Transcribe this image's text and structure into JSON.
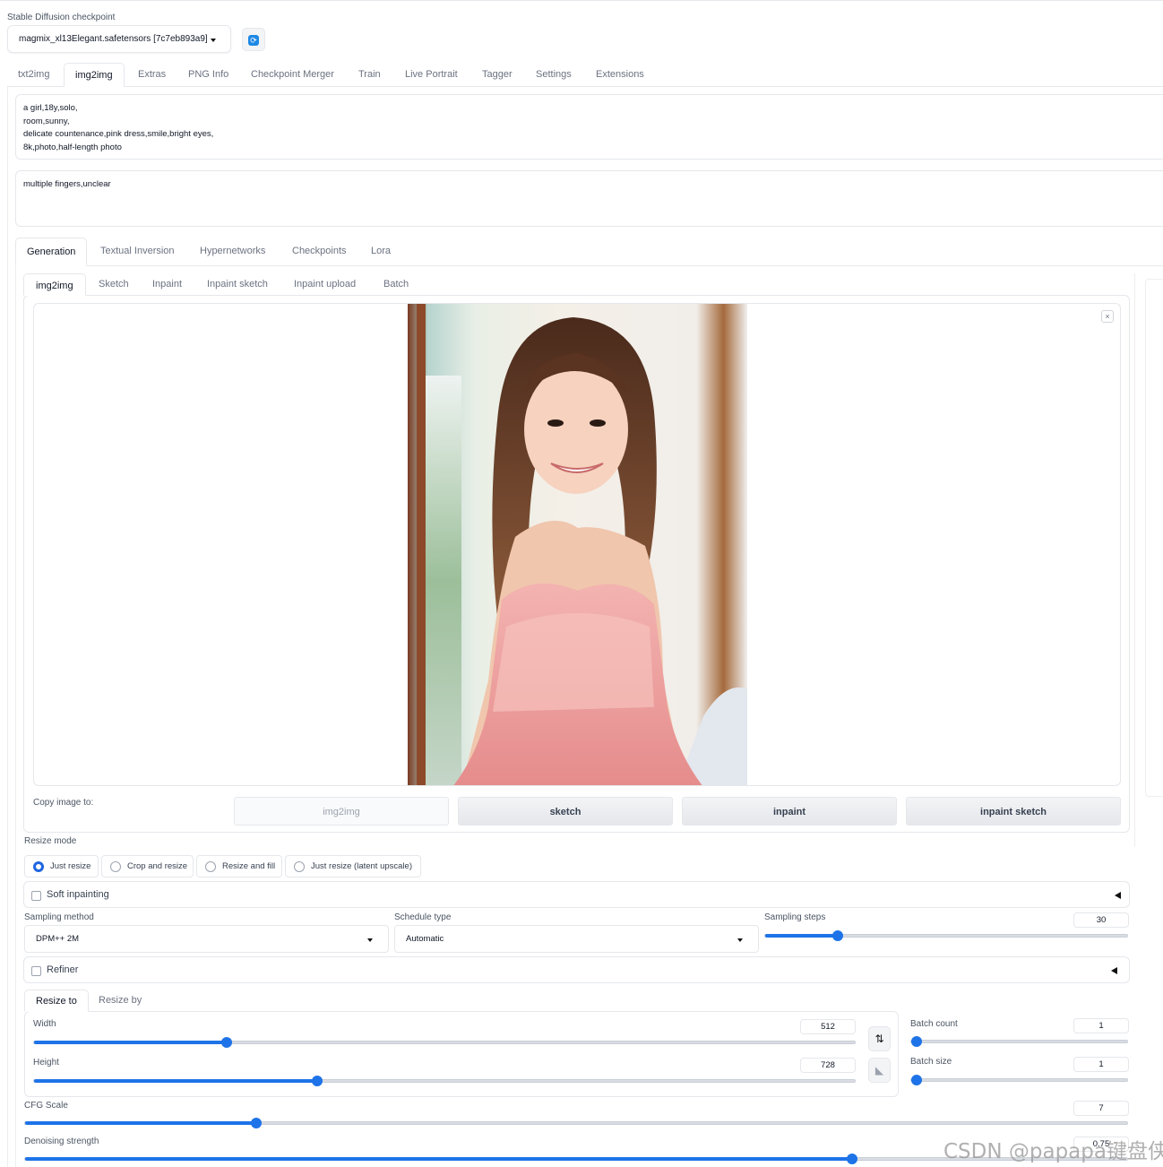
{
  "checkpoint": {
    "label": "Stable Diffusion checkpoint",
    "value": "magmix_xl13Elegant.safetensors [7c7eb893a9]"
  },
  "main_tabs": [
    {
      "label": "txt2img",
      "active": false
    },
    {
      "label": "img2img",
      "active": true
    },
    {
      "label": "Extras",
      "active": false
    },
    {
      "label": "PNG Info",
      "active": false
    },
    {
      "label": "Checkpoint Merger",
      "active": false
    },
    {
      "label": "Train",
      "active": false
    },
    {
      "label": "Live Portrait",
      "active": false
    },
    {
      "label": "Tagger",
      "active": false
    },
    {
      "label": "Settings",
      "active": false
    },
    {
      "label": "Extensions",
      "active": false
    }
  ],
  "prompt": {
    "positive": "a girl,18y,solo,\nroom,sunny,\ndelicate countenance,pink dress,smile,bright eyes,\n8k,photo,half-length photo",
    "negative": "multiple fingers,unclear"
  },
  "sub_tabs": [
    {
      "label": "Generation",
      "active": true
    },
    {
      "label": "Textual Inversion",
      "active": false
    },
    {
      "label": "Hypernetworks",
      "active": false
    },
    {
      "label": "Checkpoints",
      "active": false
    },
    {
      "label": "Lora",
      "active": false
    }
  ],
  "mode_tabs": [
    {
      "label": "img2img",
      "active": true
    },
    {
      "label": "Sketch",
      "active": false
    },
    {
      "label": "Inpaint",
      "active": false
    },
    {
      "label": "Inpaint sketch",
      "active": false
    },
    {
      "label": "Inpaint upload",
      "active": false
    },
    {
      "label": "Batch",
      "active": false
    }
  ],
  "image_close": "×",
  "copy_to": {
    "label": "Copy image to:",
    "buttons": [
      {
        "label": "img2img",
        "disabled": true
      },
      {
        "label": "sketch",
        "disabled": false
      },
      {
        "label": "inpaint",
        "disabled": false
      },
      {
        "label": "inpaint sketch",
        "disabled": false
      }
    ]
  },
  "resize_mode": {
    "label": "Resize mode",
    "options": [
      "Just resize",
      "Crop and resize",
      "Resize and fill",
      "Just resize (latent upscale)"
    ],
    "selected": "Just resize"
  },
  "soft_inpainting": "Soft inpainting",
  "sampling": {
    "method_label": "Sampling method",
    "method": "DPM++ 2M",
    "schedule_label": "Schedule type",
    "schedule": "Automatic",
    "steps_label": "Sampling steps",
    "steps": "30",
    "steps_fraction": 0.2
  },
  "refiner": "Refiner",
  "size_tabs": [
    {
      "label": "Resize to",
      "active": true
    },
    {
      "label": "Resize by",
      "active": false
    }
  ],
  "dimensions": {
    "width_label": "Width",
    "width": "512",
    "width_fraction": 0.235,
    "height_label": "Height",
    "height": "728",
    "height_fraction": 0.345
  },
  "batch": {
    "count_label": "Batch count",
    "count": "1",
    "count_fraction": 0.0,
    "size_label": "Batch size",
    "size": "1",
    "size_fraction": 0.0
  },
  "cfg": {
    "label": "CFG Scale",
    "value": "7",
    "fraction": 0.21
  },
  "denoise": {
    "label": "Denoising strength",
    "value": "0.75",
    "fraction": 0.75
  },
  "icons": {
    "swap": "⇅",
    "ratio": "◣",
    "refresh": "⟳"
  },
  "watermark": "CSDN @papapa键盘侠",
  "colors": {
    "accent": "#1e73e8",
    "border": "#e5e7eb"
  }
}
